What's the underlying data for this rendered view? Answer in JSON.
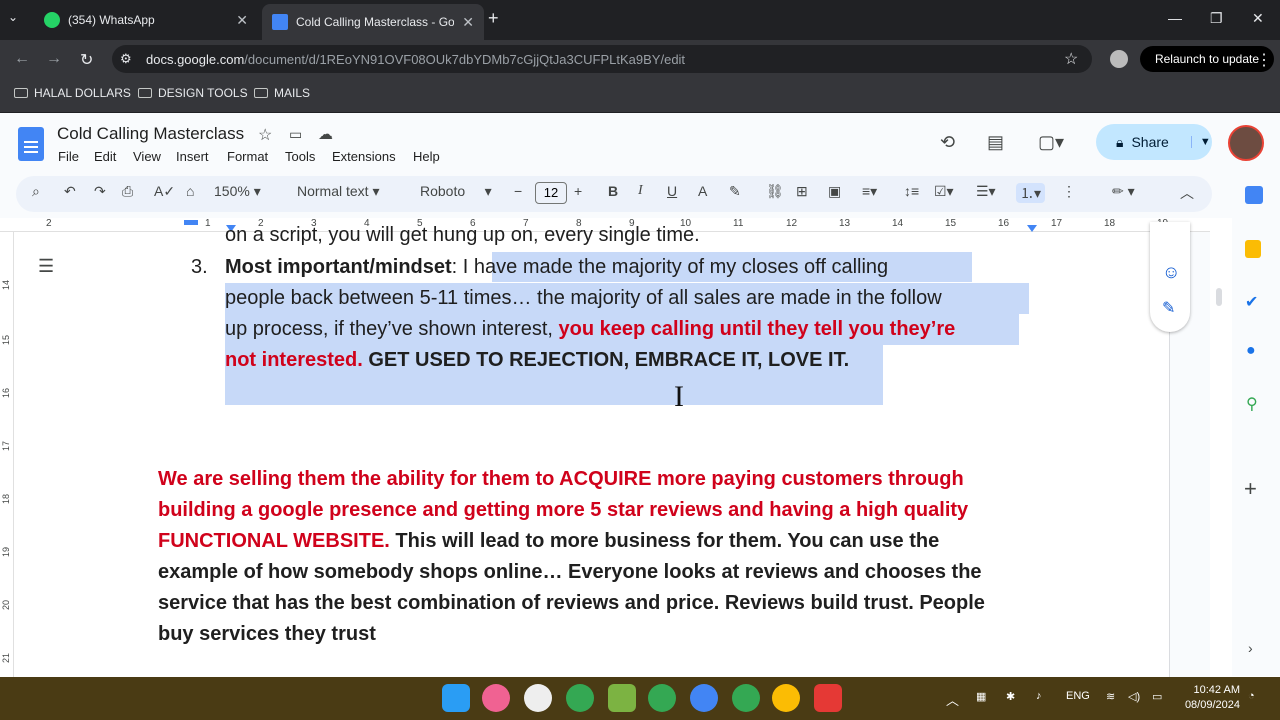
{
  "browser": {
    "tabs": [
      {
        "title": "(354) WhatsApp",
        "active": false
      },
      {
        "title": "Cold Calling Masterclass - Goo",
        "active": true
      }
    ],
    "url_host": "docs.google.com",
    "url_path": "/document/d/1REoYN91OVF08OUk7dbYDMb7cGjjQtJa3CUFPLtKa9BY/edit",
    "relaunch_label": "Relaunch to update",
    "bookmarks": [
      "HALAL DOLLARS",
      "DESIGN TOOLS",
      "MAILS"
    ]
  },
  "docs": {
    "title": "Cold Calling Masterclass",
    "menu": [
      "File",
      "Edit",
      "View",
      "Insert",
      "Format",
      "Tools",
      "Extensions",
      "Help"
    ],
    "share_label": "Share",
    "toolbar": {
      "zoom": "150%",
      "style": "Normal text",
      "font": "Roboto",
      "font_size": "12"
    },
    "ruler_numbers": [
      "2",
      "1",
      "1",
      "2",
      "3",
      "4",
      "5",
      "6",
      "7",
      "8",
      "9",
      "10",
      "11",
      "12",
      "13",
      "14",
      "15",
      "16",
      "17",
      "18",
      "19"
    ],
    "vruler_numbers": [
      "14",
      "15",
      "16",
      "17",
      "18",
      "19",
      "20",
      "21"
    ]
  },
  "content": {
    "line_top_partial": "on a script, you will get hung up on, every single time.",
    "item_number": "3.",
    "item_heading": "Most important/mindset",
    "item_colon": ": I ",
    "item_line1": "have made the majority of my closes off calling",
    "item_line2": "people back between 5-11 times… the majority of all sales are made in the follow",
    "item_line3_a": "up process, if they’ve shown interest, ",
    "item_line3_red": "you keep calling until they tell you they’re",
    "item_line4_red": "not interested.",
    "item_line4_bold": " GET USED TO REJECTION, EMBRACE IT, LOVE IT.",
    "para_red1": "We are selling them the ability for them to ACQUIRE more paying customers through",
    "para_red2": "building a google presence and getting more 5 star reviews and having a high quality",
    "para_red3": "FUNCTIONAL WEBSITE.",
    "para_bold3": " This will lead to more business for them. You can use the",
    "para_bold4": "example of how somebody shops online… Everyone looks at reviews and chooses the",
    "para_bold5": "service that has the best combination of reviews and price. Reviews build trust. People",
    "para_bold6": "buy services they trust"
  },
  "taskbar": {
    "lang": "ENG",
    "time": "10:42 AM",
    "date": "08/09/2024"
  },
  "colors": {
    "accent_red": "#d0021b",
    "selection": "#c7d9f8",
    "share_bg": "#c2e7ff"
  }
}
